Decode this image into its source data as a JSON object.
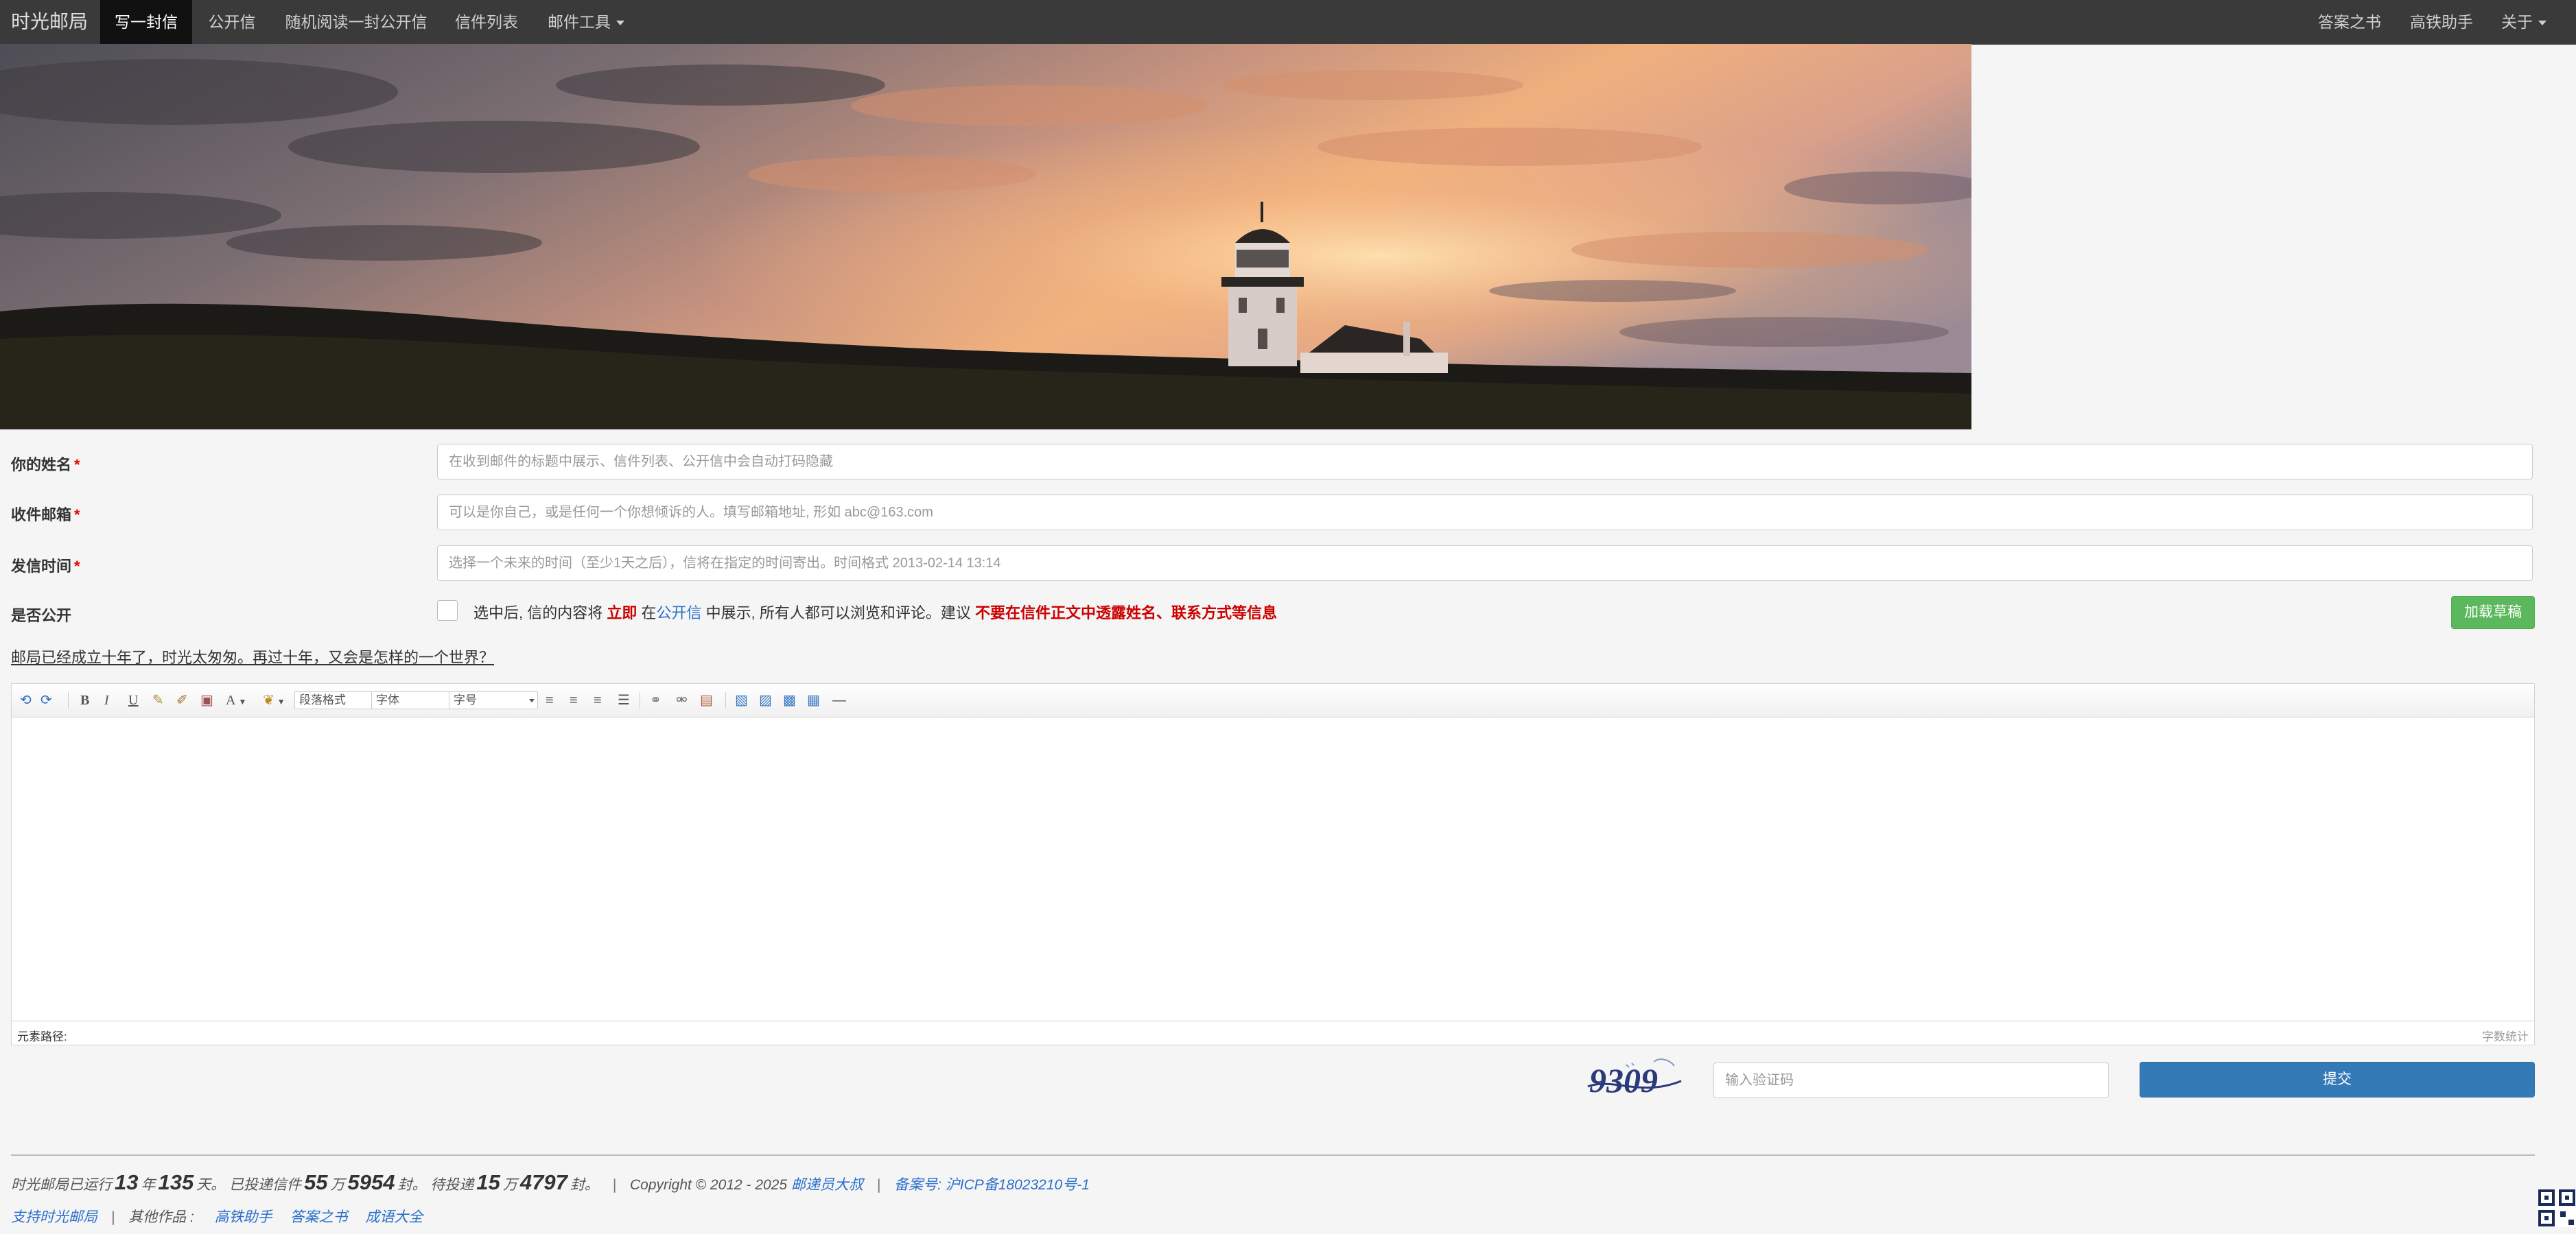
{
  "nav": {
    "brand": "时光邮局",
    "items": [
      {
        "label": "写一封信",
        "active": true
      },
      {
        "label": "公开信",
        "active": false
      },
      {
        "label": "随机阅读一封公开信",
        "active": false
      },
      {
        "label": "信件列表",
        "active": false
      },
      {
        "label": "邮件工具",
        "active": false,
        "dropdown": true
      }
    ],
    "right_items": [
      {
        "label": "答案之书"
      },
      {
        "label": "高铁助手"
      },
      {
        "label": "关于",
        "dropdown": true
      }
    ]
  },
  "banner": {
    "image": "lighthouse-sunset"
  },
  "form": {
    "name": {
      "label": "你的姓名",
      "required_mark": "*",
      "value": "",
      "placeholder": "在收到邮件的标题中展示、信件列表、公开信中会自动打码隐藏"
    },
    "email": {
      "label": "收件邮箱",
      "required_mark": "*",
      "value": "",
      "placeholder": "可以是你自己，或是任何一个你想倾诉的人。填写邮箱地址, 形如 abc@163.com"
    },
    "time": {
      "label": "发信时间",
      "required_mark": "*",
      "value": "",
      "placeholder": "选择一个未来的时间（至少1天之后），信将在指定的时间寄出。时间格式 2013-02-14 13:14"
    },
    "public": {
      "label": "是否公开",
      "checked": false,
      "text_1": "选中后, 信的内容将 ",
      "text_immediate": "立即",
      "text_2": " 在",
      "text_link": "公开信",
      "text_3": " 中展示, 所有人都可以浏览和评论。建议 ",
      "text_warning": "不要在信件正文中透露姓名、联系方式等信息"
    },
    "load_draft_button": "加载草稿",
    "slogan": "邮局已经成立十年了，时光太匆匆。再过十年，又会是怎样的一个世界？"
  },
  "editor": {
    "toolbar": {
      "paragraph_format": "段落格式",
      "font_family": "字体",
      "font_size": "字号",
      "bold": "B",
      "italic": "I",
      "underline": "U",
      "font_color": "A",
      "horizontal_rule": "—"
    },
    "element_path_label": "元素路径:",
    "word_count_label": "字数统计",
    "content": ""
  },
  "captcha": {
    "image_text": "9309",
    "placeholder": "输入验证码",
    "value": ""
  },
  "submit_button": "提交",
  "footer": {
    "stats": {
      "prefix": "时光邮局已运行",
      "years": "13",
      "years_unit": "年",
      "days": "135",
      "days_unit": "天。  已投递信件",
      "sent_wan": "55",
      "wan_unit": "万",
      "sent_rest": "5954",
      "sent_unit": "封。  待投递",
      "pending_wan": "15",
      "wan_unit_2": "万",
      "pending_rest": "4797",
      "pending_unit": "封。"
    },
    "copyright": "Copyright © 2012 - 2025",
    "author_link": "邮递员大叔",
    "icp_link": "备案号: 沪ICP备18023210号-1",
    "support_link": "支持时光邮局",
    "other_works_label": "其他作品 :",
    "other_works": [
      "高铁助手",
      "答案之书",
      "成语大全"
    ]
  },
  "colors": {
    "navbar_bg": "#3a3a3a",
    "nav_active_bg": "#111111",
    "draft_button": "#5cb85c",
    "submit_button": "#337ab7",
    "warning_red": "#cc0000",
    "link_blue": "#2a6fc9"
  }
}
